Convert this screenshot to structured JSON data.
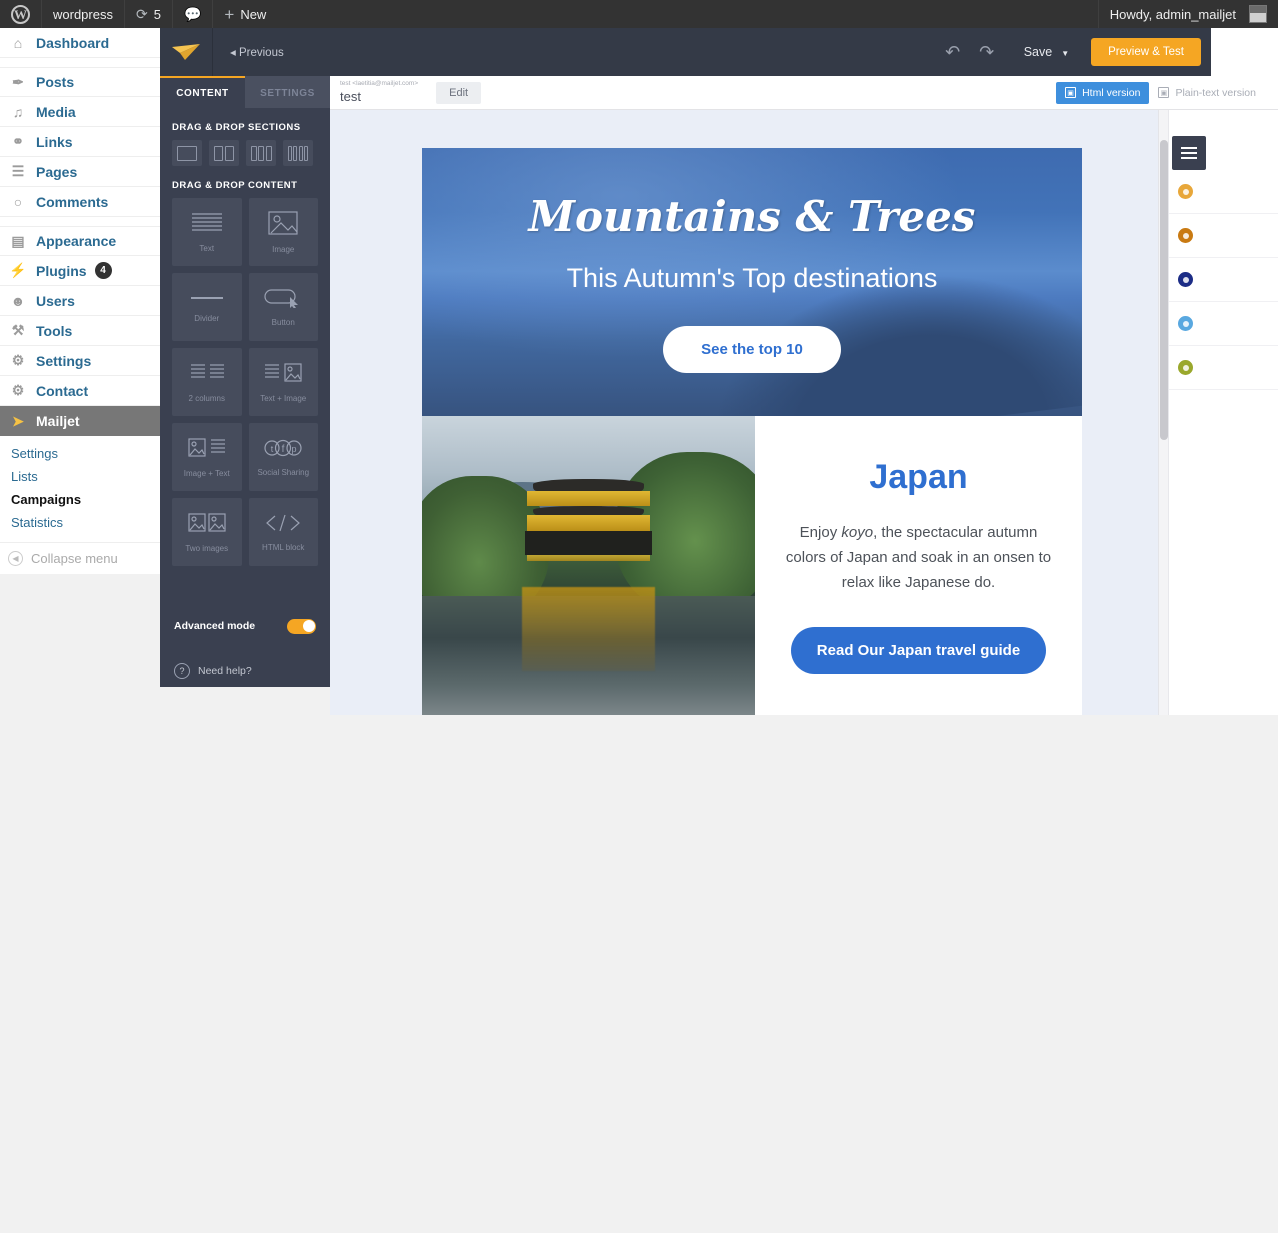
{
  "adminbar": {
    "logo_icon": "wordpress-logo-icon",
    "site_name": "wordpress",
    "updates_icon": "updates-icon",
    "updates_count": "5",
    "comments_icon": "comments-bubble-icon",
    "new_icon": "plus-icon",
    "new_label": "New",
    "howdy": "Howdy, admin_mailjet",
    "avatar_icon": "user-avatar"
  },
  "sidebar": {
    "items": [
      {
        "label": "Dashboard",
        "icon": "dashboard-home-icon",
        "badge": null
      },
      {
        "label": "Posts",
        "icon": "pin-icon",
        "badge": null
      },
      {
        "label": "Media",
        "icon": "media-icon",
        "badge": null
      },
      {
        "label": "Links",
        "icon": "link-icon",
        "badge": null
      },
      {
        "label": "Pages",
        "icon": "pages-icon",
        "badge": null
      },
      {
        "label": "Comments",
        "icon": "comment-bubble-icon",
        "badge": null
      },
      {
        "label": "Appearance",
        "icon": "appearance-icon",
        "badge": null
      },
      {
        "label": "Plugins",
        "icon": "plug-icon",
        "badge": "4"
      },
      {
        "label": "Users",
        "icon": "users-icon",
        "badge": null
      },
      {
        "label": "Tools",
        "icon": "tools-icon",
        "badge": null
      },
      {
        "label": "Settings",
        "icon": "settings-sliders-icon",
        "badge": null
      },
      {
        "label": "Contact",
        "icon": "gear-icon",
        "badge": null
      },
      {
        "label": "Mailjet",
        "icon": "mailjet-paperplane-icon",
        "badge": null
      }
    ],
    "submenu": [
      {
        "label": "Settings"
      },
      {
        "label": "Lists"
      },
      {
        "label": "Campaigns"
      },
      {
        "label": "Statistics"
      }
    ],
    "collapse_label": "Collapse menu",
    "collapse_icon": "chevron-left-icon"
  },
  "editor": {
    "topbar": {
      "logo_icon": "mailjet-paperplane-icon",
      "previous_label": "◂ Previous",
      "undo_icon": "undo-icon",
      "redo_icon": "redo-icon",
      "save_label": "Save",
      "save_caret_icon": "chevron-down-icon",
      "preview_label": "Preview & Test",
      "preview_color": "#f5a623"
    },
    "panel": {
      "tabs": [
        {
          "label": "CONTENT",
          "active": true
        },
        {
          "label": "SETTINGS",
          "active": false
        }
      ],
      "sections_heading": "DRAG & DROP SECTIONS",
      "sections": [
        {
          "name": "section-1-column",
          "columns": 1
        },
        {
          "name": "section-2-columns",
          "columns": 2
        },
        {
          "name": "section-3-columns",
          "columns": 3
        },
        {
          "name": "section-4-columns",
          "columns": 4
        }
      ],
      "content_heading": "DRAG & DROP CONTENT",
      "content_blocks": [
        {
          "label": "Text",
          "icon": "text-lines-icon"
        },
        {
          "label": "Image",
          "icon": "image-icon"
        },
        {
          "label": "Divider",
          "icon": "divider-line-icon"
        },
        {
          "label": "Button",
          "icon": "button-cursor-icon"
        },
        {
          "label": "2 columns",
          "icon": "two-columns-icon"
        },
        {
          "label": "Text + Image",
          "icon": "text-image-icon"
        },
        {
          "label": "Image + Text",
          "icon": "image-text-icon"
        },
        {
          "label": "Social Sharing",
          "icon": "social-sharing-icon"
        },
        {
          "label": "Two images",
          "icon": "two-images-icon"
        },
        {
          "label": "HTML block",
          "icon": "code-brackets-icon"
        }
      ],
      "advanced_mode_label": "Advanced mode",
      "advanced_mode_on": true,
      "need_help_label": "Need help?",
      "need_help_icon": "question-mark-icon"
    },
    "canvas_header": {
      "from_line": "test <laetitia@mailjet.com>",
      "subject": "test",
      "edit_label": "Edit",
      "versions": [
        {
          "label": "Html version",
          "icon": "html-version-icon",
          "active": true
        },
        {
          "label": "Plain-text version",
          "icon": "plain-text-icon",
          "active": false
        }
      ]
    },
    "right_rail": {
      "menu_icon": "hamburger-menu-icon",
      "swatches": [
        {
          "name": "swatch-gold",
          "color": "#e8a73a"
        },
        {
          "name": "swatch-orange",
          "color": "#c97a12"
        },
        {
          "name": "swatch-navy",
          "color": "#1c2c86"
        },
        {
          "name": "swatch-light-blue",
          "color": "#59a8e0"
        },
        {
          "name": "swatch-olive",
          "color": "#9aa82c"
        }
      ]
    }
  },
  "email": {
    "hero": {
      "title": "Mountains & Trees",
      "subtitle": "This Autumn's Top destinations",
      "cta_label": "See the top 10",
      "cta_text_color": "#2f6fd0"
    },
    "japan": {
      "photo_alt": "golden-pavilion-photo",
      "title": "Japan",
      "title_color": "#2f6fd0",
      "body_prefix": "Enjoy ",
      "body_italic": "koyo",
      "body_rest": ", the spectacular autumn colors of Japan and soak in an onsen to relax like Japanese do.",
      "cta_label": "Read Our Japan travel guide",
      "cta_color": "#2f6fd0"
    }
  }
}
